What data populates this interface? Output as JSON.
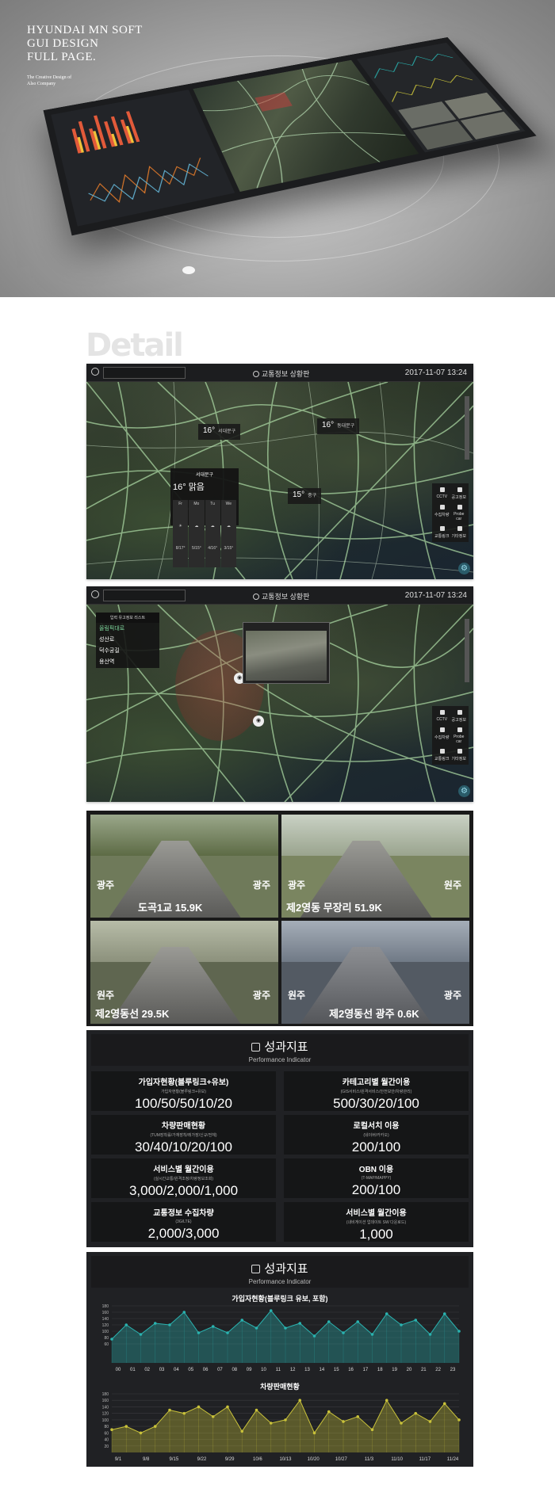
{
  "hero": {
    "title_lines": [
      "HYUNDAI MN SOFT",
      "GUI DESIGN",
      "FULL PAGE."
    ],
    "sub_lines": [
      "The Creative Design of",
      "Also Company"
    ]
  },
  "detail_heading": "Detail",
  "panel1": {
    "title": "교통정보 상황판",
    "datetime": "2017-11-07  13:24",
    "weather_tags": [
      {
        "temp": "16°",
        "place": "서대문구"
      },
      {
        "temp": "16°",
        "place": "동대문구"
      },
      {
        "temp": "15°",
        "place": "중구"
      }
    ],
    "weather_card": {
      "place": "서대문구",
      "summary": "16° 맑음",
      "days": [
        {
          "day": "Fr",
          "temp": "8/17°"
        },
        {
          "day": "Mo",
          "temp": "5/15°"
        },
        {
          "day": "Tu",
          "temp": "4/16°"
        },
        {
          "day": "We",
          "temp": "3/15°"
        }
      ]
    },
    "controls": [
      "CCTV",
      "공고정보",
      "수집차량",
      "Probe car",
      "교통링크",
      "기타정보"
    ]
  },
  "panel2": {
    "title": "교통정보 상황판",
    "datetime": "2017-11-07  13:24",
    "list_header": "입력 유고정보 리스트",
    "incidents": [
      {
        "name": "올림픽대로",
        "active": true
      },
      {
        "name": "성산로",
        "active": false
      },
      {
        "name": "덕수궁길",
        "active": false
      },
      {
        "name": "용산역",
        "active": false
      }
    ],
    "controls": [
      "CCTV",
      "공고정보",
      "수집차량",
      "Probe car",
      "교통링크",
      "기타정보"
    ]
  },
  "cctv": [
    {
      "left_dir": "광주",
      "right_dir": "광주",
      "label": "도곡1교 15.9K"
    },
    {
      "left_dir": "광주",
      "right_dir": "원주",
      "label": "제2영동 무장리 51.9K"
    },
    {
      "left_dir": "원주",
      "right_dir": "광주",
      "label": "제2영동선 29.5K"
    },
    {
      "left_dir": "원주",
      "right_dir": "광주",
      "label": "제2영동선 광주 0.6K"
    }
  ],
  "kpi": {
    "title": "성과지표",
    "subtitle": "Performance Indicator",
    "cells": [
      {
        "title": "가입자현황(블루링크+유보)",
        "sub": "가입자현황(블루링크+유보)",
        "value": "100/50/50/10/20"
      },
      {
        "title": "카테고리별 월간이용",
        "sub": "(GIS서비스/원격서비스/안전보안/차량관리)",
        "value": "500/30/20/100"
      },
      {
        "title": "차량판매현황",
        "sub": "(TUM장착률/가재장착/레가장/신규/전체)",
        "value": "30/40/10/20/100"
      },
      {
        "title": "로컬서치 이용",
        "sub": "(네이버/카카오)",
        "value": "200/100"
      },
      {
        "title": "서비스별 월간이용",
        "sub": "(실시간교통/원격조정/차량정보조회)",
        "value": "3,000/2,000/1,000"
      },
      {
        "title": "OBN 이용",
        "sub": "(T-MAP/MAPPY)",
        "value": "200/100"
      },
      {
        "title": "교통정보 수집차량",
        "sub": "(3G/LTE)",
        "value": "2,000/3,000"
      },
      {
        "title": "서비스별 월간이용",
        "sub": "(내비게이션 업데이트 SW 다운로드)",
        "value": "1,000"
      }
    ]
  },
  "kpi_charts": {
    "title": "성과지표",
    "subtitle": "Performance Indicator",
    "chart_data": [
      {
        "type": "area",
        "title": "가입자현황(블루링크 유보, 포함)",
        "ylim": [
          0,
          180
        ],
        "yticks": [
          "180",
          "160",
          "140",
          "120",
          "100",
          "80",
          "60"
        ],
        "categories": [
          "00",
          "01",
          "02",
          "03",
          "04",
          "05",
          "06",
          "07",
          "08",
          "09",
          "10",
          "11",
          "12",
          "13",
          "14",
          "15",
          "16",
          "17",
          "18",
          "19",
          "20",
          "21",
          "22",
          "23"
        ],
        "values": [
          75,
          120,
          90,
          125,
          120,
          160,
          95,
          115,
          95,
          135,
          110,
          165,
          110,
          125,
          85,
          130,
          95,
          130,
          90,
          155,
          120,
          135,
          90,
          155,
          100
        ],
        "color": "#2ab3b0"
      },
      {
        "type": "area",
        "title": "차량판매현황",
        "ylim": [
          0,
          180
        ],
        "yticks": [
          "180",
          "160",
          "140",
          "120",
          "100",
          "80",
          "60",
          "40",
          "20"
        ],
        "categories": [
          "9/1",
          "9/8",
          "9/15",
          "9/22",
          "9/29",
          "10/6",
          "10/13",
          "10/20",
          "10/27",
          "11/3",
          "11/10",
          "11/17",
          "11/24"
        ],
        "values": [
          70,
          80,
          60,
          80,
          130,
          120,
          140,
          110,
          140,
          65,
          130,
          90,
          100,
          160,
          60,
          125,
          95,
          110,
          70,
          160,
          90,
          120,
          95,
          150,
          100
        ],
        "color": "#c9c23a"
      }
    ]
  }
}
